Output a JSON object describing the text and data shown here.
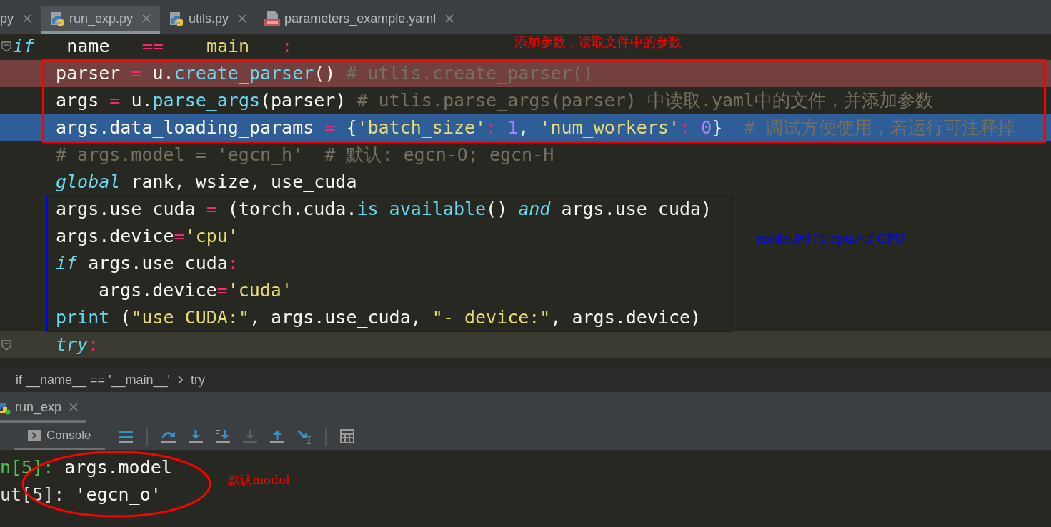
{
  "tabs": [
    {
      "label": "py",
      "kind": "plain",
      "selected": false
    },
    {
      "label": "run_exp.py",
      "kind": "python",
      "selected": true
    },
    {
      "label": "utils.py",
      "kind": "python",
      "selected": false
    },
    {
      "label": "parameters_example.yaml",
      "kind": "yaml",
      "selected": false
    }
  ],
  "code_lines": [
    {
      "fold": true,
      "selected": false,
      "tokens": [
        {
          "kind": "keyword",
          "text": "if"
        },
        {
          "kind": "plain",
          "text": " __name__ "
        },
        {
          "kind": "op",
          "text": "=="
        },
        {
          "kind": "string",
          "text": "  __main__ "
        },
        {
          "kind": "op",
          "text": ":"
        }
      ],
      "children": [
        {
          "breakpoint": true,
          "selected": false,
          "tokens": [
            {
              "kind": "plain",
              "text": "parser "
            },
            {
              "kind": "op",
              "text": "="
            },
            {
              "kind": "plain",
              "text": " u."
            },
            {
              "kind": "func",
              "text": "create_parser"
            },
            {
              "kind": "plain",
              "text": "() "
            },
            {
              "kind": "comment",
              "text": "# utlis.create_parser()"
            }
          ]
        },
        {
          "selected": false,
          "tokens": [
            {
              "kind": "plain",
              "text": "args "
            },
            {
              "kind": "op",
              "text": "="
            },
            {
              "kind": "plain",
              "text": " u."
            },
            {
              "kind": "func",
              "text": "parse_args"
            },
            {
              "kind": "plain",
              "text": "(parser) "
            },
            {
              "kind": "comment",
              "text": "# utlis.parse_args(parser) 中读取.yaml中的文件，并添加参数"
            }
          ]
        },
        {
          "selected": true,
          "tokens": [
            {
              "kind": "plain",
              "text": "args.data_loading_params "
            },
            {
              "kind": "op",
              "text": "="
            },
            {
              "kind": "plain",
              "text": " {"
            },
            {
              "kind": "string",
              "text": "'batch_size'"
            },
            {
              "kind": "op",
              "text": ": "
            },
            {
              "kind": "number",
              "text": "1"
            },
            {
              "kind": "plain",
              "text": ", "
            },
            {
              "kind": "string",
              "text": "'num_workers'"
            },
            {
              "kind": "op",
              "text": ": "
            },
            {
              "kind": "number",
              "text": "0"
            },
            {
              "kind": "plain",
              "text": "}  "
            },
            {
              "kind": "comment",
              "text": "# 调试方便使用，若运行可注释掉"
            }
          ]
        },
        {
          "selected": false,
          "tokens": [
            {
              "kind": "comment",
              "text": "# args.model = 'egcn_h'  # 默认: egcn-O; egcn-H"
            }
          ]
        },
        {
          "selected": false,
          "tokens": [
            {
              "kind": "keyword",
              "text": "global"
            },
            {
              "kind": "plain",
              "text": " rank, wsize, use_cuda"
            }
          ]
        },
        {
          "selected": false,
          "tokens": [
            {
              "kind": "plain",
              "text": "args.use_cuda "
            },
            {
              "kind": "op",
              "text": "="
            },
            {
              "kind": "plain",
              "text": " (torch.cuda."
            },
            {
              "kind": "func",
              "text": "is_available"
            },
            {
              "kind": "plain",
              "text": "() "
            },
            {
              "kind": "keyword",
              "text": "and"
            },
            {
              "kind": "plain",
              "text": " args.use_cuda)"
            }
          ]
        },
        {
          "selected": false,
          "tokens": [
            {
              "kind": "plain",
              "text": "args.device"
            },
            {
              "kind": "op",
              "text": "="
            },
            {
              "kind": "string",
              "text": "'cpu'"
            }
          ]
        },
        {
          "selected": false,
          "tokens": [
            {
              "kind": "keyword",
              "text": "if"
            },
            {
              "kind": "plain",
              "text": " args.use_cuda"
            },
            {
              "kind": "op",
              "text": ":"
            }
          ],
          "children": [
            {
              "selected": false,
              "tokens": [
                {
                  "kind": "plain",
                  "text": "args.device"
                },
                {
                  "kind": "op",
                  "text": "="
                },
                {
                  "kind": "string",
                  "text": "'cuda'"
                }
              ]
            }
          ]
        },
        {
          "selected": false,
          "tokens": [
            {
              "kind": "func",
              "text": "print"
            },
            {
              "kind": "plain",
              "text": " ("
            },
            {
              "kind": "string",
              "text": "\"use CUDA:\""
            },
            {
              "kind": "plain",
              "text": ", args.use_cuda, "
            },
            {
              "kind": "string",
              "text": "\"- device:\""
            },
            {
              "kind": "plain",
              "text": ", args.device)"
            }
          ]
        },
        {
          "fold": true,
          "caret_line": true,
          "selected": false,
          "tokens": [
            {
              "kind": "keyword",
              "text": "try"
            },
            {
              "kind": "op",
              "text": ":"
            }
          ]
        }
      ]
    }
  ],
  "breadcrumb": [
    "if __name__ == '__main__'",
    "try"
  ],
  "run_tab": {
    "label": "run_exp",
    "selected": true
  },
  "console_tab": {
    "label": "Console",
    "selected": true
  },
  "toolbar": [
    {
      "kind": "lines"
    },
    {
      "kind": "separator"
    },
    {
      "kind": "step-over",
      "disabled": false
    },
    {
      "kind": "step-into",
      "disabled": false
    },
    {
      "kind": "step-into-my-code",
      "disabled": false
    },
    {
      "kind": "step-into",
      "disabled": true
    },
    {
      "kind": "step-out",
      "disabled": false
    },
    {
      "kind": "run-to-cursor",
      "disabled": false
    },
    {
      "kind": "separator"
    },
    {
      "kind": "table"
    }
  ],
  "console": [
    {
      "prompt": "n[5]:",
      "kind": "in",
      "text": " args.model"
    },
    {
      "prompt": "ut[5]:",
      "kind": "out",
      "text": " 'egcn_o'"
    }
  ],
  "annotations": [
    {
      "kind": "label",
      "text": "添加参数，读取文件中的参数",
      "color": "#ff0000"
    },
    {
      "kind": "box",
      "color": "#ff0000"
    },
    {
      "kind": "box",
      "color": "#0000ff"
    },
    {
      "kind": "label",
      "text": "model运行是cpu还是GPU",
      "color": "#0000ff"
    },
    {
      "kind": "ellipse",
      "color": "#ff0000"
    },
    {
      "kind": "label",
      "text": "默认model",
      "color": "#ff0000"
    }
  ]
}
